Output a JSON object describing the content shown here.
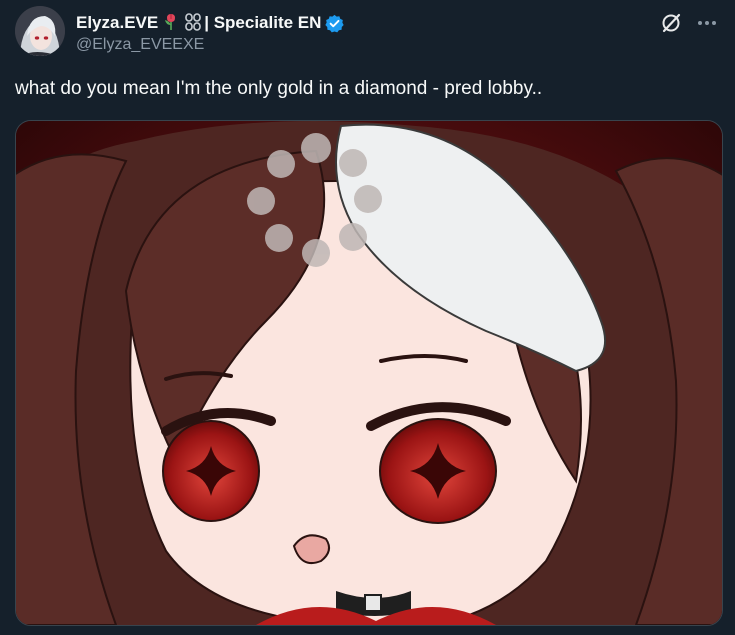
{
  "tweet": {
    "author": {
      "display_name": "Elyza.EVE",
      "emojis": [
        "tulip-icon",
        "chain-icon"
      ],
      "name_suffix": "| Specialite EN",
      "verified": true,
      "handle": "@Elyza_EVEEXE",
      "avatar_icon": "avatar-portrait-icon"
    },
    "text": "what do you mean I'm the only gold in a diamond - pred lobby..",
    "media": {
      "kind": "image",
      "icon": "chibi-character-icon"
    },
    "actions": {
      "grok_icon": "grok-slash-icon",
      "more_icon": "more-dots-icon"
    }
  },
  "colors": {
    "background": "#15202b",
    "text": "#f7f9f9",
    "secondary_text": "#8b98a5",
    "verified_blue": "#1d9bf0",
    "border": "#38444d"
  }
}
